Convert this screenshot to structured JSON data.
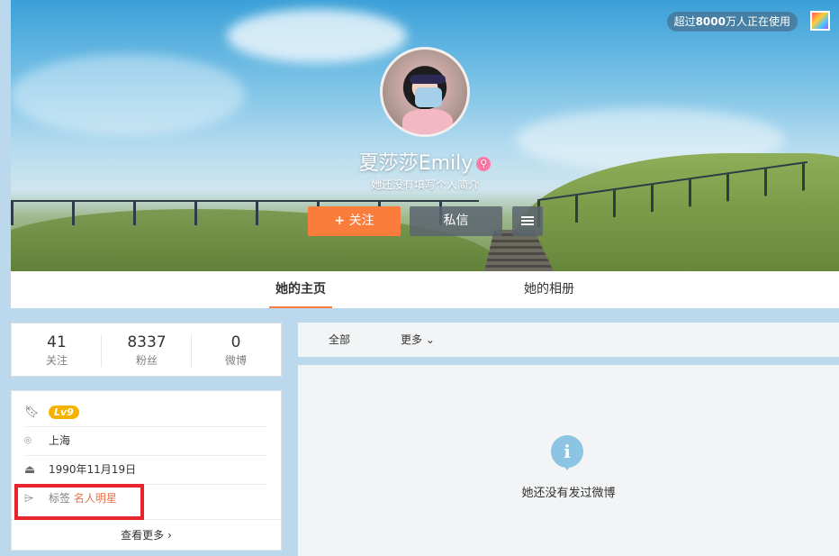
{
  "header": {
    "counter_prefix": "超过",
    "counter_number": "8000",
    "counter_suffix": "万人正在使用",
    "username": "夏莎莎Emily",
    "intro": "她还没有填写个人简介",
    "follow_label": "关注",
    "message_label": "私信"
  },
  "tabs": [
    {
      "label": "她的主页",
      "active": true
    },
    {
      "label": "她的相册",
      "active": false
    }
  ],
  "stats": [
    {
      "value": "41",
      "label": "关注"
    },
    {
      "value": "8337",
      "label": "粉丝"
    },
    {
      "value": "0",
      "label": "微博"
    }
  ],
  "info": {
    "level": "Lv9",
    "location": "上海",
    "birthday": "1990年11月19日",
    "tag_label": "标签",
    "tag_value": "名人明星",
    "more_label": "查看更多"
  },
  "feed": {
    "tab_all": "全部",
    "tab_more": "更多",
    "empty_text": "她还没有发过微博"
  },
  "colors": {
    "accent": "#fa7d3c",
    "highlight_box": "#e8242d",
    "tag_link": "#eb7350"
  }
}
